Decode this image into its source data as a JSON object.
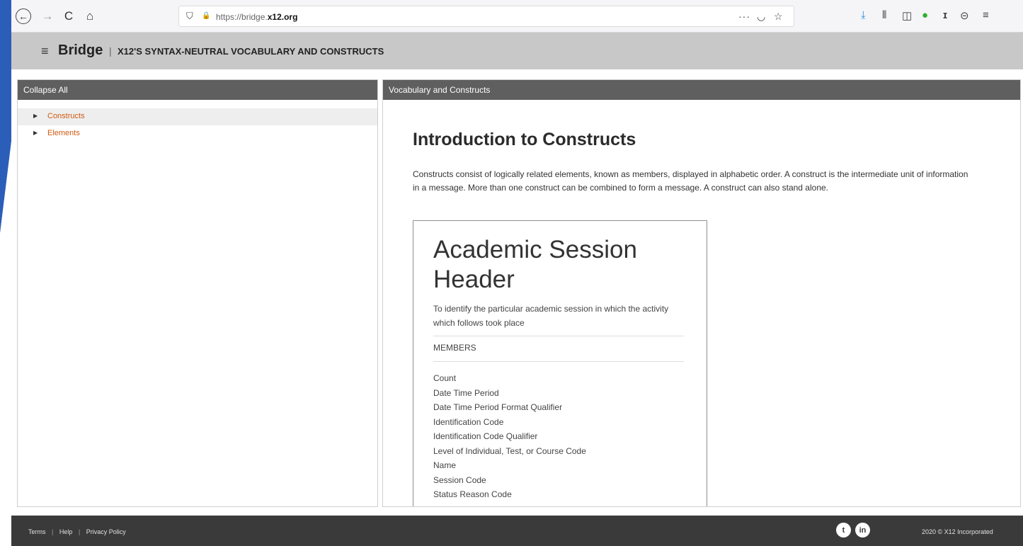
{
  "browser": {
    "url_prefix": "https://bridge.",
    "url_domain": "x12.org",
    "icons": {
      "back": "←",
      "forward": "→",
      "reload": "C",
      "home": "⌂",
      "shield": "⛉",
      "lock": "🔒",
      "more": "···",
      "pocket": "◡",
      "star": "☆",
      "download": "⤓",
      "library": "⫴",
      "sidebar": "◫",
      "extension": "●",
      "info": "ɪ",
      "account": "⊝",
      "menu": "≡"
    },
    "accent_download": "#2b8be0",
    "accent_extension": "#30b02e"
  },
  "header": {
    "menu_icon": "≡",
    "brand": "Bridge",
    "separator": "|",
    "subtitle": "X12'S SYNTAX-NEUTRAL VOCABULARY AND CONSTRUCTS"
  },
  "left_panel": {
    "header": "Collapse All",
    "items": [
      {
        "label": "Constructs",
        "selected": true
      },
      {
        "label": "Elements",
        "selected": false
      }
    ]
  },
  "right_panel": {
    "header": "Vocabulary and Constructs",
    "title": "Introduction to Constructs",
    "intro": "Constructs consist of logically related elements, known as members, displayed in alphabetic order. A construct is the intermediate unit of information in a message. More than one construct can be combined to form a message. A construct can also stand alone.",
    "card": {
      "title": "Academic Session Header",
      "description": "To identify the particular academic session in which the activity which follows took place",
      "members_heading": "MEMBERS",
      "members": [
        "Count",
        "Date Time Period",
        "Date Time Period Format Qualifier",
        "Identification Code",
        "Identification Code Qualifier",
        "Level of Individual, Test, or Course Code",
        "Name",
        "Session Code",
        "Status Reason Code"
      ]
    }
  },
  "footer": {
    "links": [
      "Terms",
      "Help",
      "Privacy Policy"
    ],
    "link_separator": "|",
    "twitter_icon": "t",
    "linkedin_icon": "in",
    "copyright": "2020 © X12 Incorporated"
  },
  "colors": {
    "accent_blue": "#2b5eb8",
    "link_orange": "#d05a10",
    "panel_header": "#5f5f5f",
    "footer_bg": "#3a3a3a"
  }
}
